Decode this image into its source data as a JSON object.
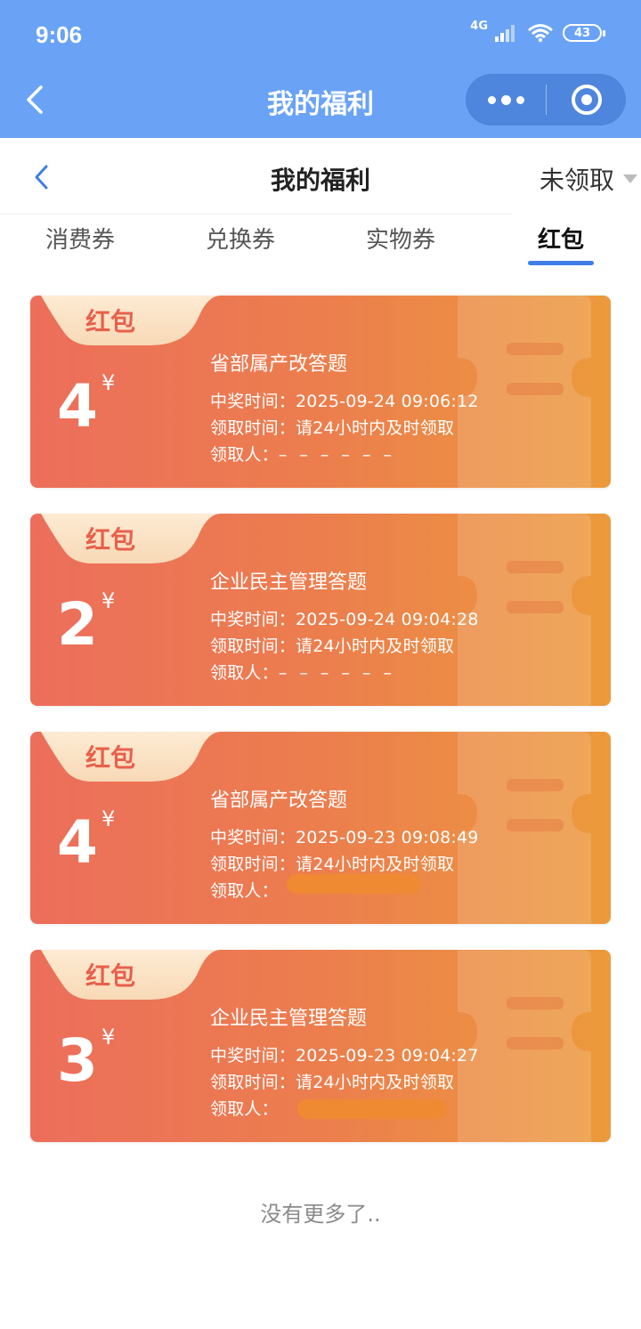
{
  "status_bar": {
    "time": "9:06",
    "network": "4G",
    "battery": "43"
  },
  "nav_bar": {
    "title": "我的福利"
  },
  "sub_header": {
    "title": "我的福利",
    "filter_label": "未领取"
  },
  "tabs": [
    {
      "label": "消费券",
      "active": false
    },
    {
      "label": "兑换券",
      "active": false
    },
    {
      "label": "实物券",
      "active": false
    },
    {
      "label": "红包",
      "active": true
    }
  ],
  "cards": [
    {
      "tag": "红包",
      "amount": "4",
      "currency": "¥",
      "name": "省部属产改答题",
      "win_time": "中奖时间：2025-09-24 09:06:12",
      "claim_time": "领取时间：请24小时内及时领取",
      "claimant_label": "领取人：",
      "claimant_value": "– – – – – –"
    },
    {
      "tag": "红包",
      "amount": "2",
      "currency": "¥",
      "name": "企业民主管理答题",
      "win_time": "中奖时间：2025-09-24 09:04:28",
      "claim_time": "领取时间：请24小时内及时领取",
      "claimant_label": "领取人：",
      "claimant_value": "– – – – – –"
    },
    {
      "tag": "红包",
      "amount": "4",
      "currency": "¥",
      "name": "省部属产改答题",
      "win_time": "中奖时间：2025-09-23 09:08:49",
      "claim_time": "领取时间：请24小时内及时领取",
      "claimant_label": "领取人：",
      "claimant_value": ""
    },
    {
      "tag": "红包",
      "amount": "3",
      "currency": "¥",
      "name": "企业民主管理答题",
      "win_time": "中奖时间：2025-09-23 09:04:27",
      "claim_time": "领取时间：请24小时内及时领取",
      "claimant_label": "领取人：",
      "claimant_value": ""
    }
  ],
  "footer": {
    "end_text": "没有更多了.."
  },
  "colors": {
    "nav_blue": "#6aa3f5",
    "capsule_blue": "#4e86dd",
    "tab_underline": "#3f7de8",
    "card_left": "#ec6e5b",
    "card_right": "#ec9a3c",
    "tag_text": "#e8604c"
  }
}
